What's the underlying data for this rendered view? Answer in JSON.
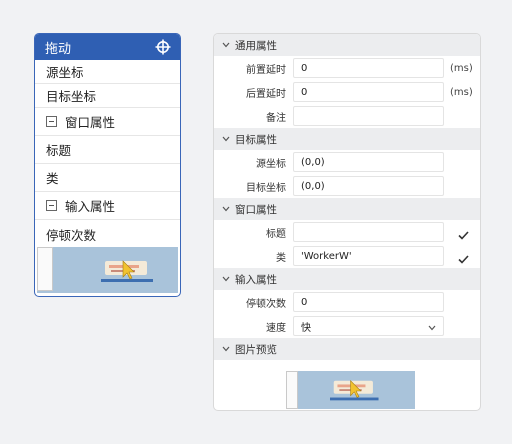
{
  "node": {
    "title": "拖动",
    "items": [
      {
        "label": "源坐标",
        "section": false
      },
      {
        "label": "目标坐标",
        "section": false
      },
      {
        "label": "窗口属性",
        "section": true
      },
      {
        "label": "标题",
        "section": false
      },
      {
        "label": "类",
        "section": false
      },
      {
        "label": "输入属性",
        "section": true
      },
      {
        "label": "停顿次数",
        "section": false
      }
    ]
  },
  "panel": {
    "general": {
      "title": "通用属性",
      "pre_delay_label": "前置延时",
      "pre_delay_value": "0",
      "pre_delay_unit": "(ms)",
      "post_delay_label": "后置延时",
      "post_delay_value": "0",
      "post_delay_unit": "(ms)",
      "note_label": "备注",
      "note_value": ""
    },
    "target": {
      "title": "目标属性",
      "source_label": "源坐标",
      "source_value": "(0,0)",
      "dest_label": "目标坐标",
      "dest_value": "(0,0)"
    },
    "window": {
      "title": "窗口属性",
      "title_label": "标题",
      "title_value": "",
      "title_checked": true,
      "class_label": "类",
      "class_value": "'WorkerW'",
      "class_checked": true
    },
    "input": {
      "title": "输入属性",
      "pause_label": "停顿次数",
      "pause_value": "0",
      "speed_label": "速度",
      "speed_value": "快"
    },
    "preview": {
      "title": "图片预览"
    }
  },
  "colors": {
    "node_header": "#2f5fb3",
    "node_border": "#3a66b8",
    "section_bg": "#ecedef",
    "preview_bg": "#a9c3da",
    "cursor": "#f2c230"
  },
  "icons": {
    "node_header_icon": "move-crosshair-icon",
    "section_toggle": "chevron-down-icon",
    "group_toggle": "collapse-minus-icon",
    "check": "checkmark-icon",
    "dropdown": "chevron-down-icon",
    "cursor": "mouse-cursor-icon"
  }
}
